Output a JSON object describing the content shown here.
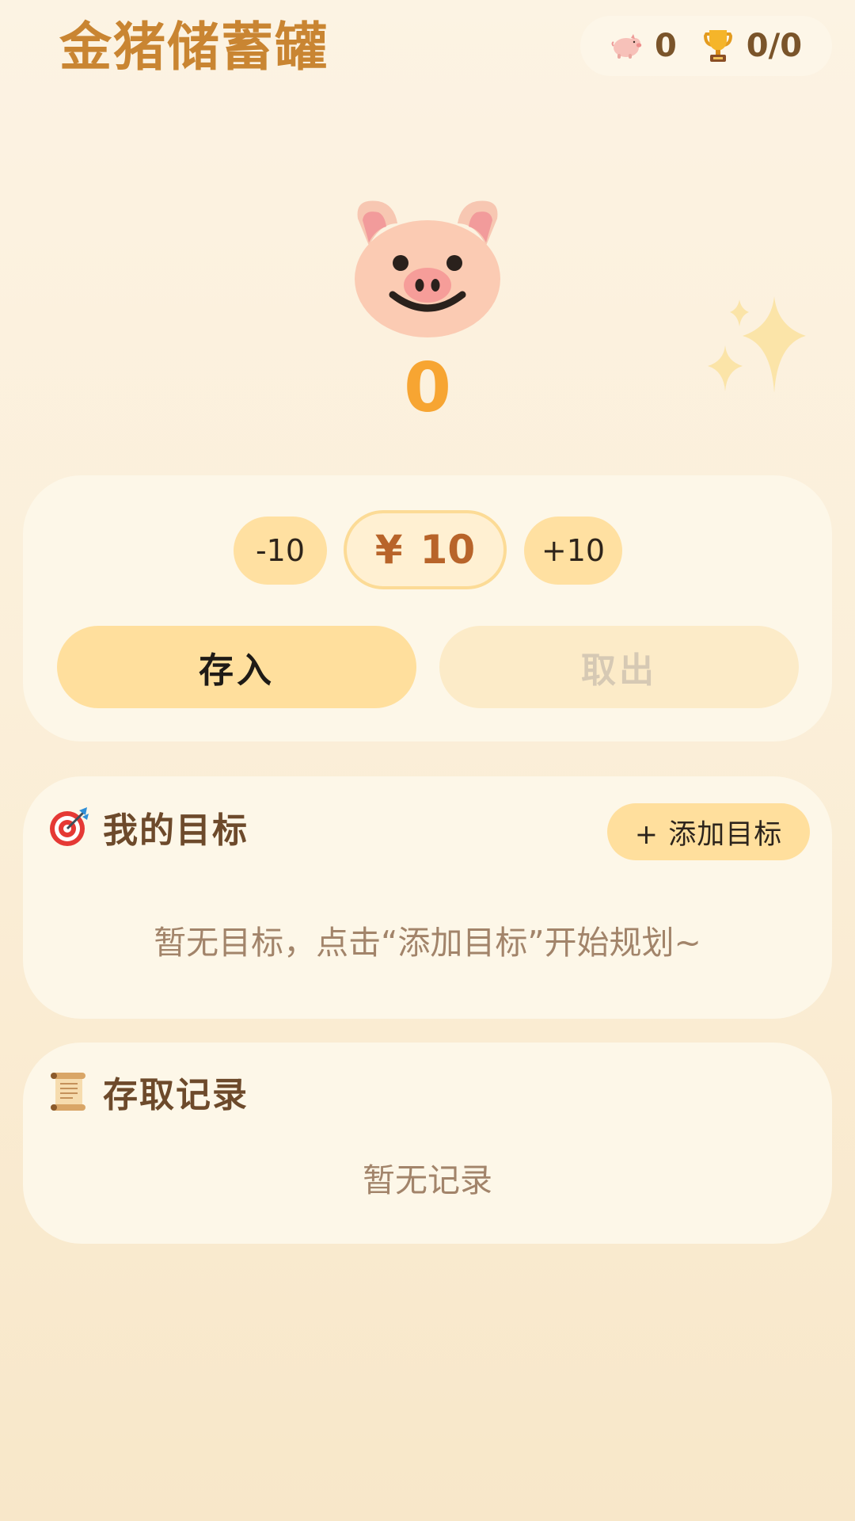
{
  "header": {
    "title": "金猪储蓄罐",
    "pig_count": "0",
    "goal_progress": "0/0"
  },
  "hero": {
    "balance": "0"
  },
  "controls": {
    "minus_label": "-10",
    "currency": "¥",
    "amount": "10",
    "plus_label": "+10",
    "deposit_label": "存入",
    "withdraw_label": "取出"
  },
  "goals": {
    "title": "我的目标",
    "add_label": "+ 添加目标",
    "empty_text": "暂无目标，点击“添加目标”开始规划~"
  },
  "records": {
    "title": "存取记录",
    "empty_text": "暂无记录"
  },
  "icons": {
    "pig_face": "pig-face-icon",
    "sparkles": "sparkles-icon",
    "mini_pig": "pig-icon",
    "trophy": "trophy-icon",
    "goal": "target-icon",
    "records": "scroll-icon"
  },
  "colors": {
    "accent": "#f7a532",
    "title": "#c98532",
    "button": "#ffdf9d",
    "card": "#fdf7e8",
    "disabled_text": "#d6c9b4"
  }
}
